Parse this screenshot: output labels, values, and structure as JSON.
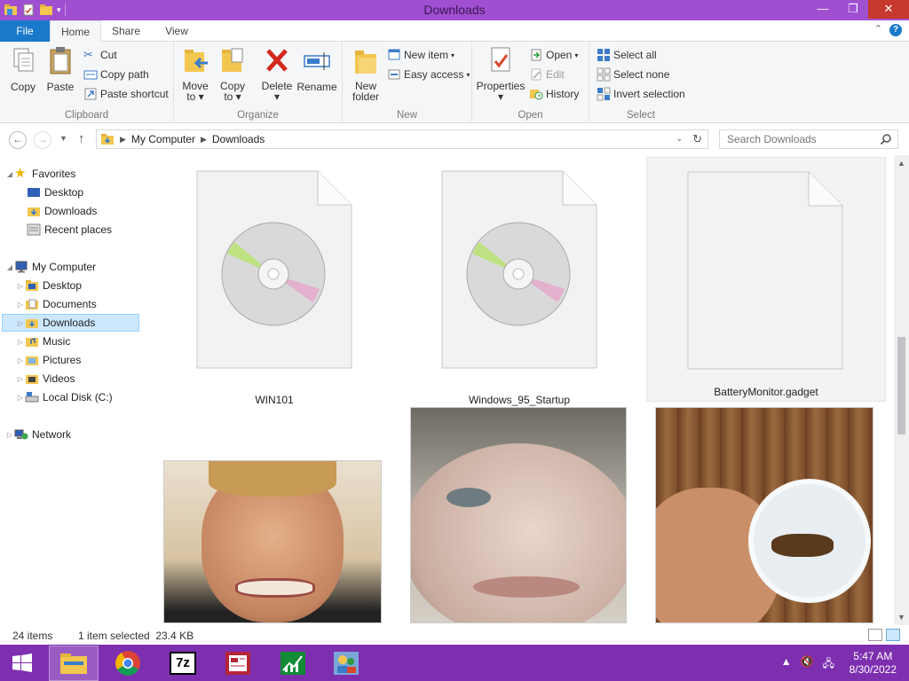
{
  "window": {
    "title": "Downloads"
  },
  "tabs": {
    "file": "File",
    "home": "Home",
    "share": "Share",
    "view": "View"
  },
  "ribbon": {
    "clipboard": {
      "label": "Clipboard",
      "copy": "Copy",
      "paste": "Paste",
      "cut": "Cut",
      "copy_path": "Copy path",
      "paste_shortcut": "Paste shortcut"
    },
    "organize": {
      "label": "Organize",
      "move_to": "Move\nto",
      "copy_to": "Copy\nto",
      "delete": "Delete",
      "rename": "Rename"
    },
    "new": {
      "label": "New",
      "new_folder": "New\nfolder",
      "new_item": "New item",
      "easy_access": "Easy access"
    },
    "open": {
      "label": "Open",
      "properties": "Properties",
      "open": "Open",
      "edit": "Edit",
      "history": "History"
    },
    "select": {
      "label": "Select",
      "select_all": "Select all",
      "select_none": "Select none",
      "invert": "Invert selection"
    }
  },
  "address": {
    "crumbs": [
      "My Computer",
      "Downloads"
    ],
    "search_placeholder": "Search Downloads"
  },
  "nav": {
    "favorites": "Favorites",
    "favorites_items": [
      "Desktop",
      "Downloads",
      "Recent places"
    ],
    "computer": "My Computer",
    "computer_items": [
      "Desktop",
      "Documents",
      "Downloads",
      "Music",
      "Pictures",
      "Videos",
      "Local Disk (C:)"
    ],
    "network": "Network"
  },
  "files": [
    {
      "name": "WIN101",
      "icon": "disc-image-icon"
    },
    {
      "name": "Windows_95_Startup",
      "icon": "disc-image-icon"
    },
    {
      "name": "BatteryMonitor.gadget",
      "icon": "blank-file-icon",
      "selected": true
    }
  ],
  "status": {
    "count": "24 items",
    "selection": "1 item selected  23.4 KB"
  },
  "clock": {
    "time": "5:47 AM",
    "date": "8/30/2022"
  },
  "colors": {
    "titlebar": "#a04fd1",
    "taskbar": "#7d2fb0",
    "file_tab": "#1979ca",
    "close": "#c7382d",
    "selection": "#cce8ff"
  }
}
